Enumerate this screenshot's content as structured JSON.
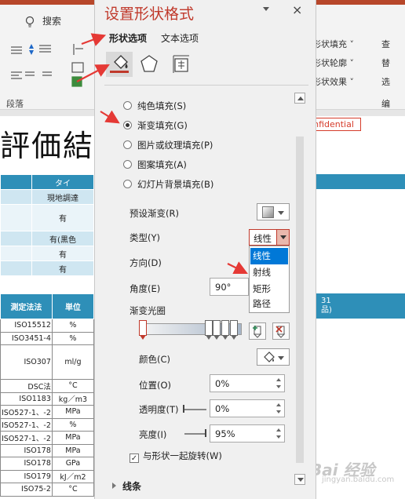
{
  "ribbon": {
    "search_label": "搜索",
    "group_label": "段落",
    "right_items": [
      "形状填充 ˅",
      "形状轮廓 ˅",
      "形状效果 ˅"
    ],
    "far_items": [
      "查",
      "替",
      "选"
    ],
    "far_group": "编"
  },
  "document": {
    "title_fragment": "評価結果",
    "confidential": "nfidential",
    "header_fragment": "タイ",
    "top_rows": [
      "現地調達",
      "有",
      "有(黒色",
      "有",
      "有"
    ],
    "header_cols": [
      "測定法法",
      "単位"
    ],
    "rows": [
      [
        "ISO15512",
        "%"
      ],
      [
        "ISO3451-4",
        "%"
      ],
      [
        "ISO307",
        "ml/g"
      ],
      [
        "DSC法",
        "°C"
      ],
      [
        "ISO1183",
        "kg／m3"
      ],
      [
        "ISO527-1、-2",
        "MPa"
      ],
      [
        "ISO527-1、-2",
        "%"
      ],
      [
        "ISO527-1、-2",
        "MPa"
      ],
      [
        "ISO178",
        "MPa"
      ],
      [
        "ISO178",
        "GPa"
      ],
      [
        "ISO179",
        "kJ／m2"
      ],
      [
        "ISO75-2",
        "°C"
      ]
    ],
    "right_header": "31\n品)"
  },
  "pane": {
    "title": "设置形状格式",
    "close": "×",
    "tabs": [
      "形状选项",
      "文本选项"
    ],
    "fill_options": [
      "纯色填充(S)",
      "渐变填充(G)",
      "图片或纹理填充(P)",
      "图案填充(A)",
      "幻灯片背景填充(B)"
    ],
    "selected_fill": 1,
    "preset_label": "预设渐变(R)",
    "type_label": "类型(Y)",
    "type_value": "线性",
    "type_options": [
      "线性",
      "射线",
      "矩形",
      "路径"
    ],
    "direction_label": "方向(D)",
    "angle_label": "角度(E)",
    "angle_value": "90°",
    "stops_label": "渐变光圈",
    "color_label": "颜色(C)",
    "position_label": "位置(O)",
    "position_value": "0%",
    "transparency_label": "透明度(T)",
    "transparency_value": "0%",
    "brightness_label": "亮度(I)",
    "brightness_value": "95%",
    "rotate_label": "与形状一起旋转(W)",
    "line_section": "线条"
  },
  "watermark": {
    "text": "Bai 经验",
    "sub": "jingyan.baidu.com"
  },
  "colors": {
    "accent": "#c0392b",
    "table_header": "#2e8fb8",
    "select_highlight": "#0078d7"
  }
}
